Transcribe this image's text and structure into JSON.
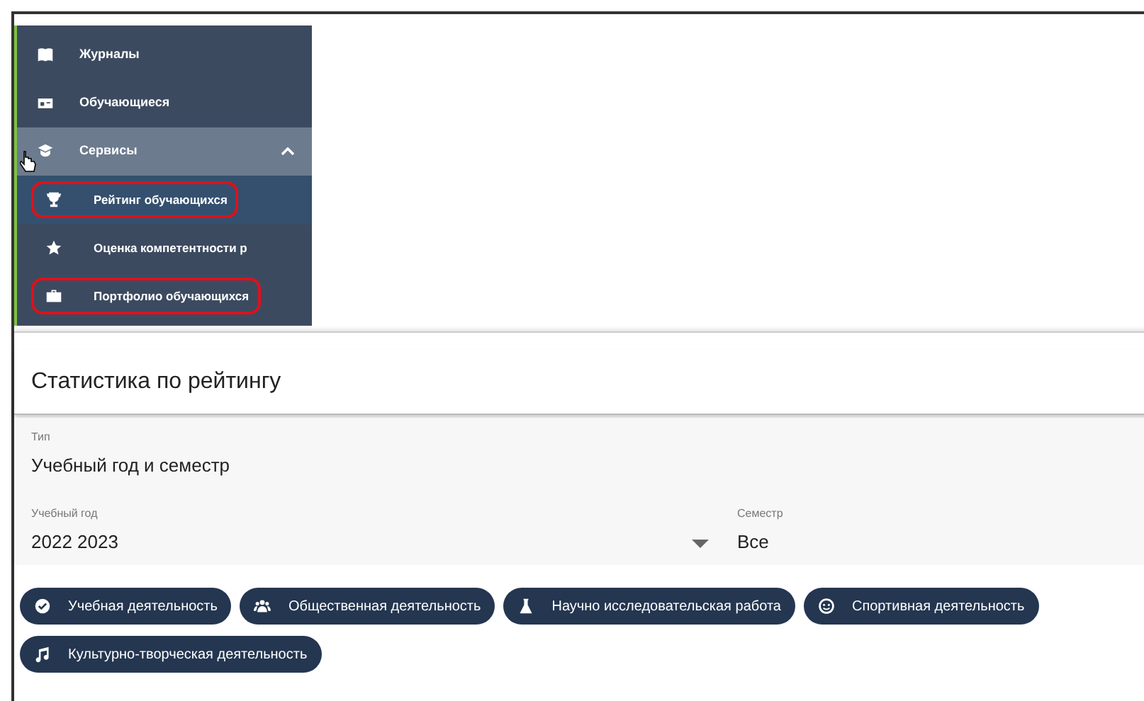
{
  "sidebar": {
    "items": [
      {
        "label": "Журналы",
        "kind": "book",
        "selected": false,
        "hovered": false
      },
      {
        "label": "Обучающиеся",
        "kind": "card",
        "selected": false,
        "hovered": false
      },
      {
        "label": "Сервисы",
        "kind": "hat",
        "selected": false,
        "hovered": true,
        "expanded": true,
        "children": [
          {
            "label": "Рейтинг обучающихся",
            "kind": "trophy",
            "selected": true,
            "highlighted": true
          },
          {
            "label": "Оценка компетентности р",
            "kind": "star",
            "selected": false,
            "highlighted": false
          },
          {
            "label": "Портфолио обучающихся",
            "kind": "briefcase",
            "selected": false,
            "highlighted": true
          }
        ]
      }
    ]
  },
  "panel": {
    "title": "Статистика по рейтингу",
    "type_field": {
      "label": "Тип",
      "value": "Учебный год и семестр"
    },
    "year_field": {
      "label": "Учебный год",
      "value": "2022 2023"
    },
    "semester_field": {
      "label": "Семестр",
      "value": "Все"
    },
    "chips": [
      {
        "label": "Учебная деятельность",
        "kind": "check"
      },
      {
        "label": "Общественная деятельность",
        "kind": "people"
      },
      {
        "label": "Научно исследовательская работа",
        "kind": "flask"
      },
      {
        "label": "Спортивная деятельность",
        "kind": "smile"
      },
      {
        "label": "Культурно-творческая деятельность",
        "kind": "music"
      }
    ]
  }
}
